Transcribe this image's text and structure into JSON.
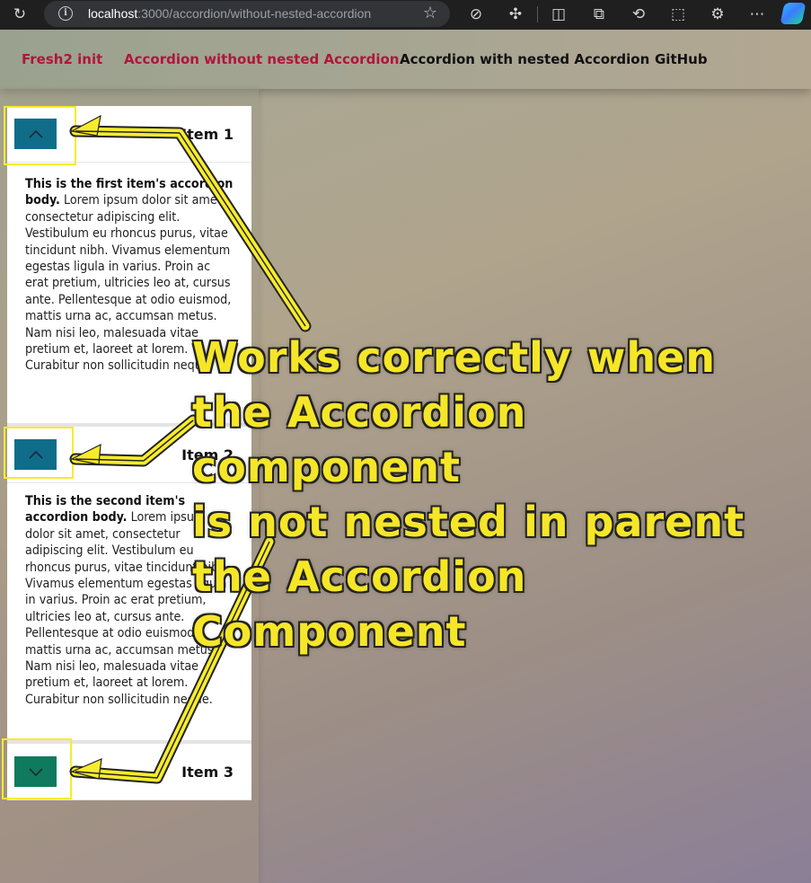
{
  "browser": {
    "url_host": "localhost",
    "url_path": ":3000/accordion/without-nested-accordion"
  },
  "nav": {
    "links": [
      {
        "label": "Fresh2 init",
        "color": "#b0153c"
      },
      {
        "label": "Accordion without nested Accordion",
        "color": "#b0153c"
      },
      {
        "label": "Accordion with nested Accordion",
        "color": "#111111"
      },
      {
        "label": "GitHub",
        "color": "#111111"
      }
    ]
  },
  "accordion": {
    "items": [
      {
        "title": "Item 1",
        "state": "expanded",
        "body_bold": "This is the first item's accordion body.",
        "body_text": " Lorem ipsum dolor sit amet, consectetur adipiscing elit. Vestibulum eu rhoncus purus, vitae tincidunt nibh. Vivamus elementum egestas ligula in varius. Proin ac erat pretium, ultricies leo at, cursus ante. Pellentesque at odio euismod, mattis urna ac, accumsan metus. Nam nisi leo, malesuada vitae pretium et, laoreet at lorem. Curabitur non sollicitudin neque."
      },
      {
        "title": "Item 2",
        "state": "expanded",
        "body_bold": "This is the second item's accordion body.",
        "body_text": " Lorem ipsum dolor sit amet, consectetur adipiscing elit. Vestibulum eu rhoncus purus, vitae tincidunt nibh. Vivamus elementum egestas ligula in varius. Proin ac erat pretium, ultricies leo at, cursus ante. Pellentesque at odio euismod, mattis urna ac, accumsan metus. Nam nisi leo, malesuada vitae pretium et, laoreet at lorem. Curabitur non sollicitudin neque."
      },
      {
        "title": "Item 3",
        "state": "collapsed"
      }
    ],
    "colors": {
      "toggle_expanded": "#0f6d8a",
      "toggle_collapsed": "#0f7a5e",
      "highlight": "#f7ec2b"
    }
  },
  "annotation": {
    "text": "Works correctly when\n the Accordion component\n  is not nested in parent\n the Accordion Component",
    "color": "#f5e628"
  }
}
